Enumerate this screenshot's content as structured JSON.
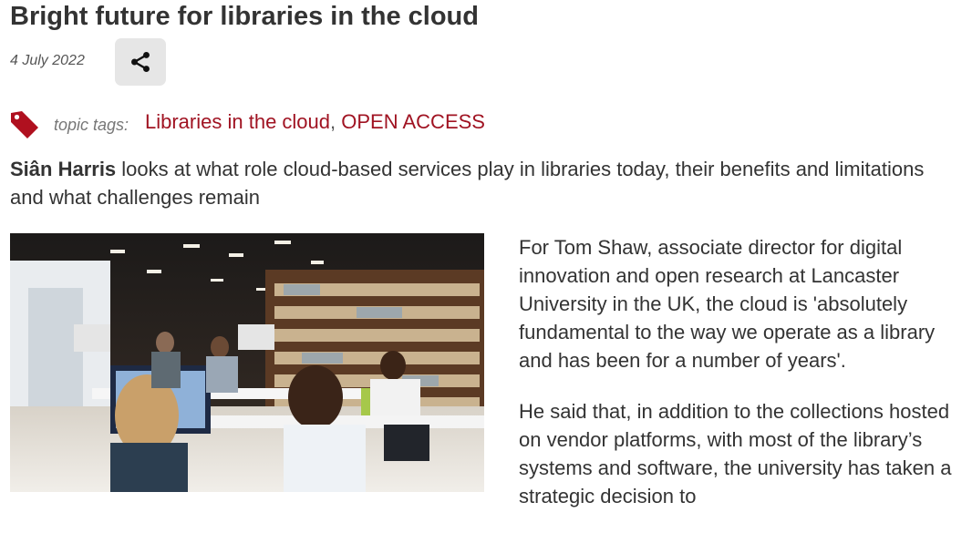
{
  "article": {
    "title": "Bright future for libraries in the cloud",
    "date": "4 July 2022",
    "share_icon": "share-icon",
    "tags_label": "topic tags:",
    "tags": [
      "Libraries in the cloud",
      "OPEN ACCESS"
    ],
    "tag_separator": ", ",
    "standfirst_author": "Siân Harris",
    "standfirst_text": " looks at what role cloud-based services play in libraries today, their benefits and limitations and what challenges remain",
    "paragraphs": [
      "For Tom Shaw, associate director for digital innovation and open research at Lancaster University in the UK, the cloud is 'absolutely fundamental to the way we operate as a library and has been for a number of years'.",
      "He said that, in addition to the collections hosted on vendor platforms, with most of the library’s systems and software, the university has taken a strategic decision to"
    ]
  },
  "colors": {
    "tag_link": "#a01322",
    "share_bg": "#e6e6e6",
    "title": "#333333"
  }
}
